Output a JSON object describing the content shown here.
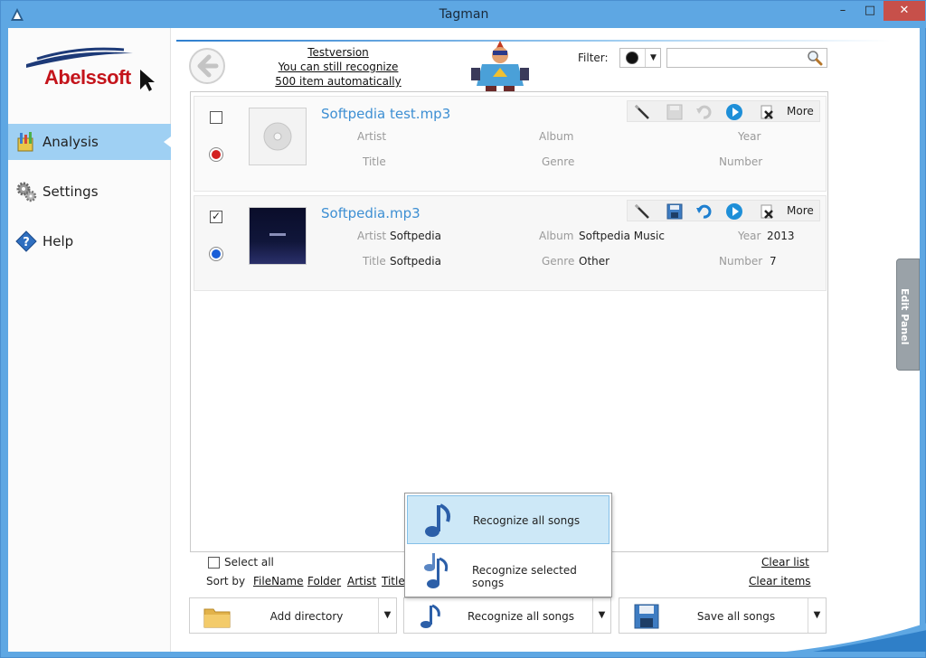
{
  "window": {
    "title": "Tagman",
    "minimize": "–",
    "maximize": "□",
    "close": "✕"
  },
  "logo": {
    "text": "Abelssoft"
  },
  "sidebar": {
    "items": [
      {
        "label": "Analysis",
        "icon": "analysis-icon",
        "active": true
      },
      {
        "label": "Settings",
        "icon": "gears-icon",
        "active": false
      },
      {
        "label": "Help",
        "icon": "help-icon",
        "active": false
      }
    ]
  },
  "header": {
    "testversion": "Testversion",
    "line2": "You can still recognize",
    "line3": "500 item automatically",
    "filter_label": "Filter:",
    "search_placeholder": ""
  },
  "items": [
    {
      "name": "Softpedia test.mp3",
      "checked": false,
      "status_color": "#d32020",
      "artist_label": "Artist",
      "artist": "",
      "album_label": "Album",
      "album": "",
      "year_label": "Year",
      "year": "",
      "title_label": "Title",
      "title": "",
      "genre_label": "Genre",
      "genre": "",
      "number_label": "Number",
      "number": "",
      "more": "More"
    },
    {
      "name": "Softpedia.mp3",
      "checked": true,
      "status_color": "#1a5fd8",
      "artist_label": "Artist",
      "artist": "Softpedia",
      "album_label": "Album",
      "album": "Softpedia Music",
      "year_label": "Year",
      "year": "2013",
      "title_label": "Title",
      "title": "Softpedia",
      "genre_label": "Genre",
      "genre": "Other",
      "number_label": "Number",
      "number": "7",
      "more": "More"
    }
  ],
  "edit_panel": {
    "label": "Edit Panel"
  },
  "footer": {
    "select_all": "Select all",
    "sort_by": "Sort by",
    "sort_links": [
      "FileName",
      "Folder",
      "Artist",
      "Title"
    ],
    "clear_list": "Clear list",
    "clear_items": "Clear items"
  },
  "buttons": {
    "add_directory": "Add directory",
    "recognize_all": "Recognize all songs",
    "save_all": "Save all songs"
  },
  "dropdown": {
    "items": [
      "Recognize all songs",
      "Recognize selected songs"
    ]
  },
  "colors": {
    "accent": "#3d8fd3",
    "sidebar_active": "#9fd0f3",
    "title_bar": "#5ea7e3"
  }
}
